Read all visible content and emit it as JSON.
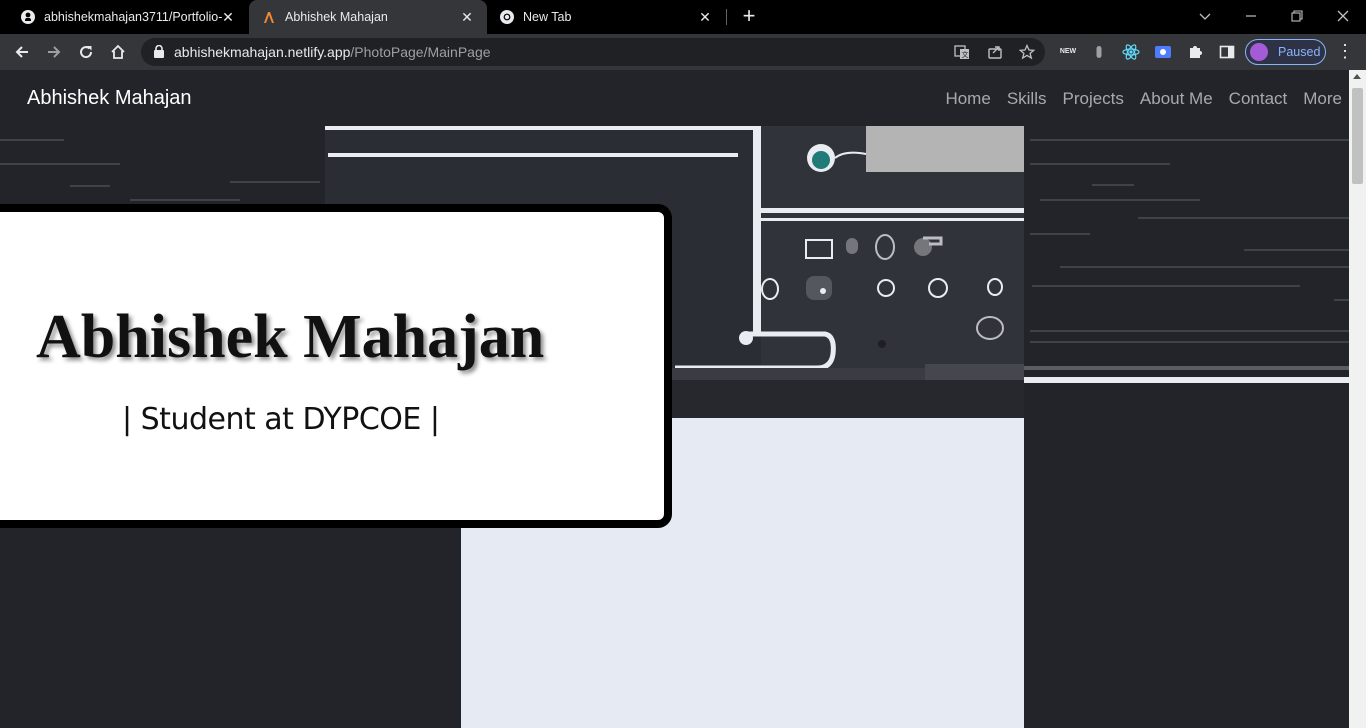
{
  "browser": {
    "tabs": [
      {
        "title": "abhishekmahajan3711/Portfolio-",
        "favicon": "github-icon",
        "active": false
      },
      {
        "title": "Abhishek Mahajan",
        "favicon": "site-icon",
        "active": true
      },
      {
        "title": "New Tab",
        "favicon": "chrome-icon",
        "active": false
      }
    ],
    "new_tab_label": "+",
    "close_glyph": "✕",
    "address": {
      "domain": "abhishekmahajan.netlify.app",
      "path": "/PhotoPage/MainPage"
    },
    "profile_label": "Paused",
    "extension_badge": "NEW"
  },
  "page": {
    "brand": "Abhishek Mahajan",
    "nav": [
      "Home",
      "Skills",
      "Projects",
      "About Me",
      "Contact",
      "More"
    ],
    "hero": {
      "name": "Abhishek Mahajan",
      "subtitle": "| Student at DYPCOE |"
    }
  },
  "colors": {
    "chrome_bg": "#000000",
    "toolbar_bg": "#35363a",
    "page_bg": "#23242a",
    "accent": "#8ab4f8"
  }
}
